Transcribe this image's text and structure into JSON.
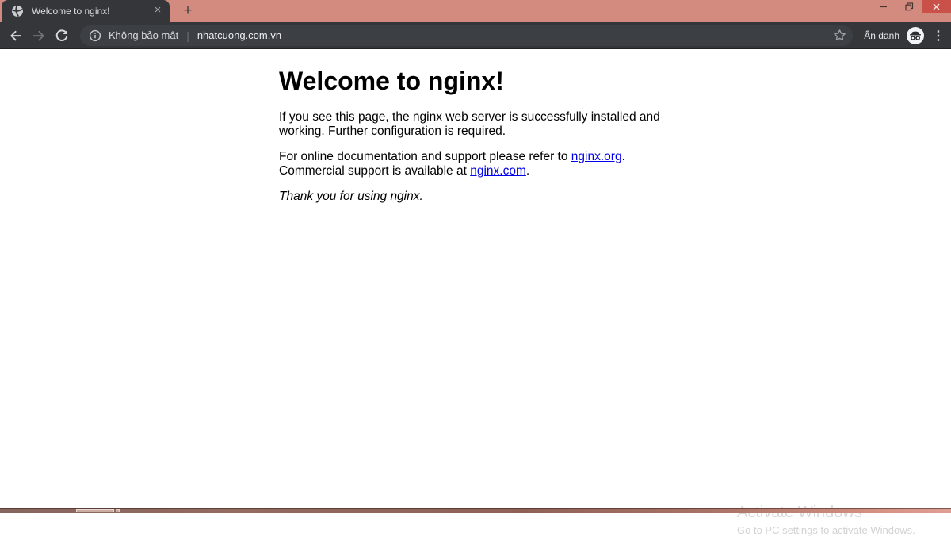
{
  "window": {
    "theme": {
      "frame_color": "#d48b7f",
      "toolbar_color": "#35363a",
      "close_button_color": "#c9514a"
    }
  },
  "tabbar": {
    "active_tab": {
      "title": "Welcome to nginx!",
      "favicon": "globe-icon",
      "close_glyph": "×"
    },
    "new_tab_glyph": "+"
  },
  "toolbar": {
    "security_label": "Không bảo mật",
    "divider_glyph": "|",
    "url": "nhatcuong.com.vn",
    "incognito_label": "Ẩn danh",
    "menu_glyph": "⋮",
    "icons": {
      "back": "back-arrow-icon",
      "forward": "forward-arrow-icon",
      "reload": "reload-icon",
      "info": "info-circle-icon",
      "star": "bookmark-star-icon",
      "incognito": "incognito-icon",
      "menu": "kebab-menu-icon"
    }
  },
  "content": {
    "heading": "Welcome to nginx!",
    "paragraph1_lines": [
      "If you see this page, the nginx web server is successfully installed and",
      "working. Further configuration is required."
    ],
    "paragraph2": {
      "text1": "For online documentation and support please refer to ",
      "link1": "nginx.org",
      "suffix1": ".",
      "text2": "Commercial support is available at ",
      "link2": "nginx.com",
      "suffix2": "."
    },
    "paragraph3": "Thank you for using nginx.",
    "link_color": "#0000ee"
  },
  "watermark": {
    "title": "Activate Windows",
    "subtitle": "Go to PC settings to activate Windows."
  }
}
